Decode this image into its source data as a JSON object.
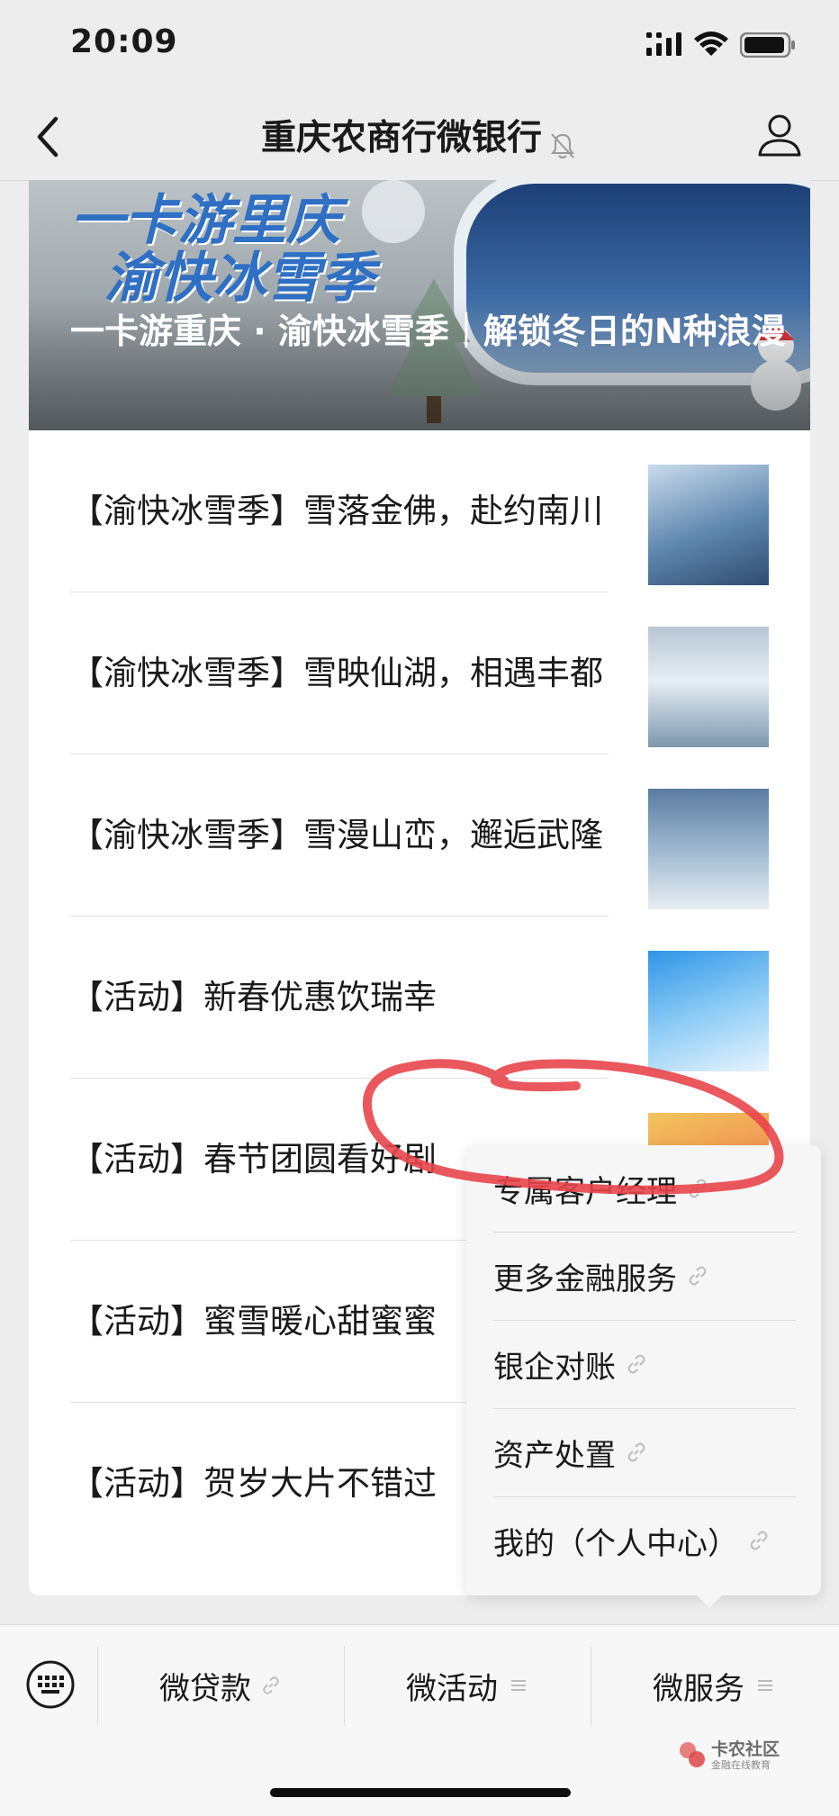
{
  "status_bar": {
    "time": "20:09"
  },
  "header": {
    "title": "重庆农商行微银行"
  },
  "banner": {
    "art_line1": "一卡游里庆",
    "art_line2": "渝快冰雪季",
    "title": "一卡游重庆 · 渝快冰雪季｜解锁冬日的N种浪漫"
  },
  "articles": [
    {
      "title": "【渝快冰雪季】雪落金佛，赴约南川"
    },
    {
      "title": "【渝快冰雪季】雪映仙湖，相遇丰都"
    },
    {
      "title": "【渝快冰雪季】雪漫山峦，邂逅武隆"
    },
    {
      "title": "【活动】新春优惠饮瑞幸"
    },
    {
      "title": "【活动】春节团圆看好剧"
    },
    {
      "title": "【活动】蜜雪暖心甜蜜蜜"
    },
    {
      "title": "【活动】贺岁大片不错过"
    }
  ],
  "popup_menu": {
    "items": [
      {
        "label": "专属客户经理"
      },
      {
        "label": "更多金融服务"
      },
      {
        "label": "银企对账"
      },
      {
        "label": "资产处置"
      },
      {
        "label": "我的（个人中心）"
      }
    ]
  },
  "bottom_menu": {
    "items": [
      {
        "label": "微贷款",
        "icon": "link-icon"
      },
      {
        "label": "微活动",
        "icon": "list-icon"
      },
      {
        "label": "微服务",
        "icon": "list-icon"
      }
    ]
  },
  "watermark": {
    "title": "卡农社区",
    "subtitle": "金融在线教育"
  },
  "colors": {
    "annotation": "#e8454a",
    "background": "#ededed"
  }
}
